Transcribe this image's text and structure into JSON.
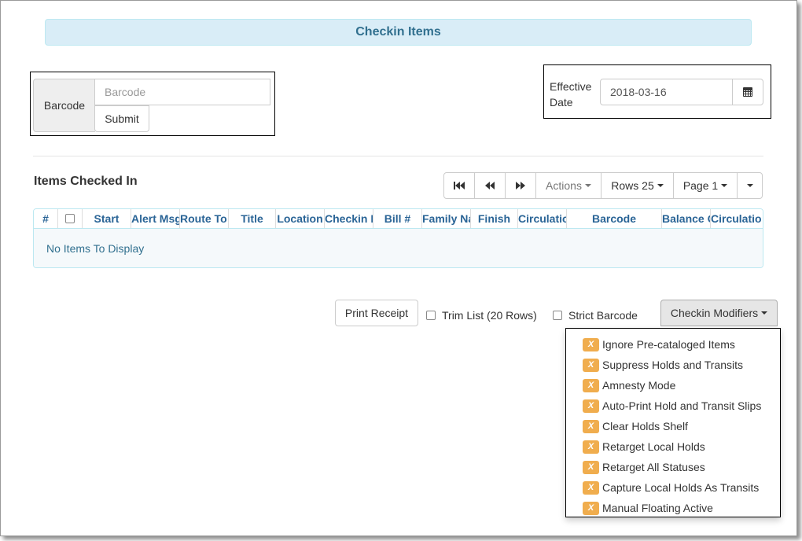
{
  "header": {
    "title": "Checkin Items"
  },
  "barcode": {
    "label": "Barcode",
    "placeholder": "Barcode",
    "submit_label": "Submit"
  },
  "effective_date": {
    "label_line1": "Effective",
    "label_line2": "Date",
    "value": "2018-03-16",
    "icon": "calendar-icon"
  },
  "grid": {
    "title": "Items Checked In",
    "toolbar": {
      "actions": "Actions",
      "rows": "Rows 25",
      "page": "Page 1"
    },
    "columns": [
      "#",
      "",
      "Start",
      "Alert Msg",
      "Route To",
      "Title",
      "Location",
      "Checkin D",
      "Bill #",
      "Family Na",
      "Finish",
      "Circulatio",
      "Barcode",
      "Balance O",
      "Circulatio"
    ],
    "empty_message": "No Items To Display"
  },
  "footer": {
    "print_receipt": "Print Receipt",
    "trim_list": "Trim List (20 Rows)",
    "strict_barcode": "Strict Barcode",
    "checkin_modifiers": "Checkin Modifiers"
  },
  "modifiers": [
    "Ignore Pre-cataloged Items",
    "Suppress Holds and Transits",
    "Amnesty Mode",
    "Auto-Print Hold and Transit Slips",
    "Clear Holds Shelf",
    "Retarget Local Holds",
    "Retarget All Statuses",
    "Capture Local Holds As Transits",
    "Manual Floating Active"
  ],
  "modifier_badge": "X",
  "colors": {
    "accent": "#31708f",
    "info_bg": "#d9edf7",
    "badge": "#f0ad4e",
    "link": "#2a6496"
  }
}
